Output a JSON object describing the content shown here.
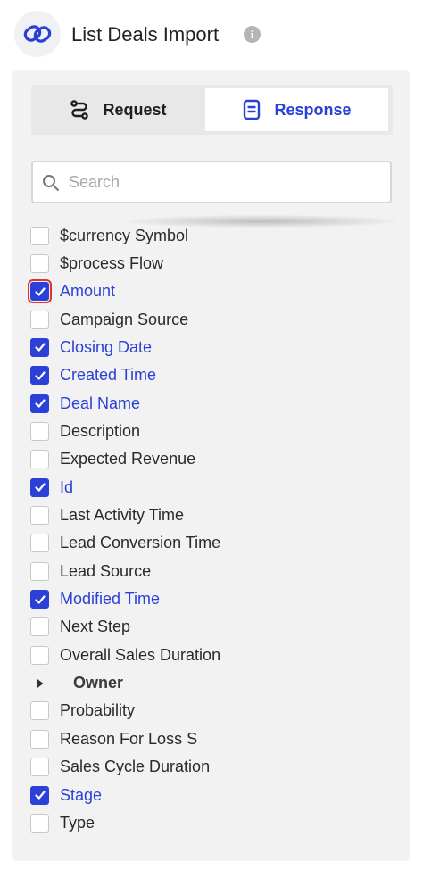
{
  "header": {
    "title": "List Deals Import",
    "logo_icon": "link-icon",
    "info_icon_glyph": "i"
  },
  "tabs": [
    {
      "label": "Request",
      "icon": "route-icon",
      "active": false
    },
    {
      "label": "Response",
      "icon": "document-icon",
      "active": true
    }
  ],
  "search": {
    "placeholder": "Search",
    "value": ""
  },
  "colors": {
    "accent": "#2a40d8",
    "focus_outline": "#e53030"
  },
  "fields": [
    {
      "label": "$currency Symbol",
      "checked": false
    },
    {
      "label": "$process Flow",
      "checked": false
    },
    {
      "label": "Amount",
      "checked": true,
      "focused": true
    },
    {
      "label": "Campaign Source",
      "checked": false
    },
    {
      "label": "Closing Date",
      "checked": true
    },
    {
      "label": "Created Time",
      "checked": true
    },
    {
      "label": "Deal Name",
      "checked": true
    },
    {
      "label": "Description",
      "checked": false
    },
    {
      "label": "Expected Revenue",
      "checked": false
    },
    {
      "label": "Id",
      "checked": true
    },
    {
      "label": "Last Activity Time",
      "checked": false
    },
    {
      "label": "Lead Conversion Time",
      "checked": false
    },
    {
      "label": "Lead Source",
      "checked": false
    },
    {
      "label": "Modified Time",
      "checked": true
    },
    {
      "label": "Next Step",
      "checked": false
    },
    {
      "label": "Overall Sales Duration",
      "checked": false
    },
    {
      "label": "Owner",
      "group": true,
      "expanded": false
    },
    {
      "label": "Probability",
      "checked": false
    },
    {
      "label": "Reason For Loss S",
      "checked": false
    },
    {
      "label": "Sales Cycle Duration",
      "checked": false
    },
    {
      "label": "Stage",
      "checked": true
    },
    {
      "label": "Type",
      "checked": false
    }
  ]
}
